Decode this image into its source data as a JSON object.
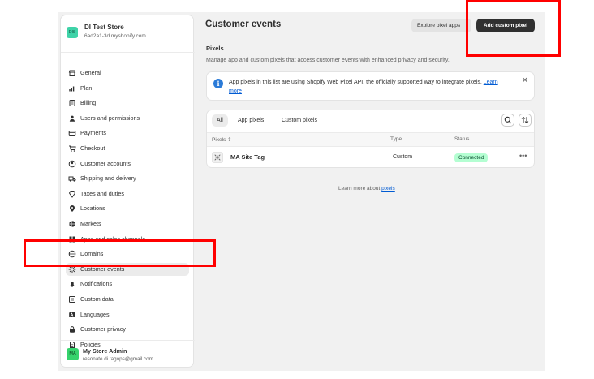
{
  "store": {
    "initials": "DIS",
    "name": "DI Test Store",
    "domain": "6ad2a1-3d.myshopify.com"
  },
  "sidebar": {
    "items": [
      {
        "label": "General",
        "icon": "store-icon"
      },
      {
        "label": "Plan",
        "icon": "chart-icon"
      },
      {
        "label": "Billing",
        "icon": "receipt-icon"
      },
      {
        "label": "Users and permissions",
        "icon": "person-icon"
      },
      {
        "label": "Payments",
        "icon": "card-icon"
      },
      {
        "label": "Checkout",
        "icon": "cart-icon"
      },
      {
        "label": "Customer accounts",
        "icon": "person-circle-icon"
      },
      {
        "label": "Shipping and delivery",
        "icon": "truck-icon"
      },
      {
        "label": "Taxes and duties",
        "icon": "tax-icon"
      },
      {
        "label": "Locations",
        "icon": "pin-icon"
      },
      {
        "label": "Markets",
        "icon": "globe-icon"
      },
      {
        "label": "Apps and sales channels",
        "icon": "apps-icon"
      },
      {
        "label": "Domains",
        "icon": "domain-icon"
      },
      {
        "label": "Customer events",
        "icon": "sparkle-icon",
        "active": true
      },
      {
        "label": "Notifications",
        "icon": "bell-icon"
      },
      {
        "label": "Custom data",
        "icon": "data-icon"
      },
      {
        "label": "Languages",
        "icon": "language-icon"
      },
      {
        "label": "Customer privacy",
        "icon": "lock-icon"
      },
      {
        "label": "Policies",
        "icon": "document-icon"
      }
    ]
  },
  "user": {
    "initials": "MA",
    "name": "My Store Admin",
    "email": "resonate.di.tagops@gmail.com"
  },
  "header": {
    "title": "Customer events",
    "explore_label": "Explore pixel apps",
    "add_label": "Add custom pixel"
  },
  "pixels": {
    "section_title": "Pixels",
    "description": "Manage app and custom pixels that access customer events with enhanced privacy and security.",
    "banner": {
      "text": "App pixels in this list are using Shopify Web Pixel API, the officially supported way to integrate pixels.",
      "link": "Learn more"
    },
    "tabs": [
      "All",
      "App pixels",
      "Custom pixels"
    ],
    "columns": {
      "pixels": "Pixels",
      "type": "Type",
      "status": "Status"
    },
    "rows": [
      {
        "name": "MA Site Tag",
        "type": "Custom",
        "status": "Connected"
      }
    ],
    "footer_prefix": "Learn more about",
    "footer_link": "pixels"
  },
  "colors": {
    "accent_dark": "#303030",
    "link": "#005bd3",
    "connected_badge": "#b4fed2",
    "annotation": "#ff0000"
  }
}
